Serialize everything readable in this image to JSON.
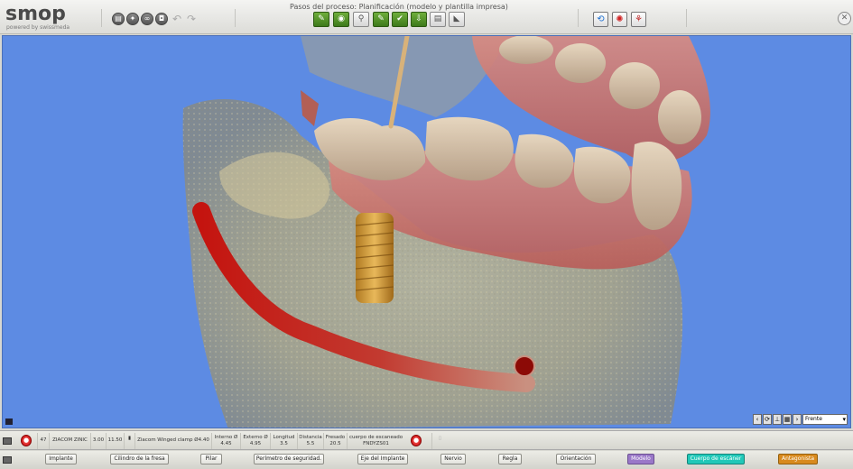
{
  "app": {
    "logo": "smop",
    "logo_sub": "powered by swissmeda"
  },
  "toolbar": {
    "steps_title": "Pasos del proceso: Planificación (modelo y plantilla impresa)",
    "left_tools": [
      "file-icon",
      "lightbulb-icon",
      "link-icon",
      "camera-icon"
    ],
    "undo_icon": "undo-icon",
    "redo_icon": "redo-icon",
    "steps": [
      "step-1",
      "step-2",
      "step-3",
      "step-4",
      "step-5",
      "step-6",
      "step-7",
      "step-8"
    ],
    "view_tools": [
      "view-rotate-icon",
      "view-settings-icon",
      "view-teeth-icon"
    ],
    "close_icon": "close-icon"
  },
  "viewport": {
    "view_select": "Frente",
    "background": "#5d8be3"
  },
  "info": {
    "number": "47",
    "system": "ZIACOM ZINIC",
    "diameter": "3.00",
    "length": "11.50",
    "implant_name": "Ziacom Winged clamp Ø4.40",
    "interno_label": "Interno Ø",
    "interno_value": "4.45",
    "externo_label": "Externo Ø",
    "externo_value": "4.95",
    "longitud_label": "Longitud",
    "longitud_value": "3.5",
    "distancia_label": "Distancia",
    "distancia_value": "5.5",
    "fresado_label": "Fresado",
    "fresado_value": "20.5",
    "cuerpo_label": "cuerpo de escaneado",
    "cuerpo_value": "FNDYZS01"
  },
  "buttons": {
    "implante": "Implante",
    "cilindro": "Cilindro de la fresa",
    "pilar": "Pilar",
    "perimetro": "Perímetro de seguridad.",
    "eje": "Eje del Implante",
    "nervio": "Nervio",
    "regla": "Regla",
    "orientacion": "Orientación",
    "modelo": "Modelo",
    "cuerpo_escaner": "Cuerpo de escáner",
    "antagonista": "Antagonista"
  },
  "colors": {
    "viewport_bg": "#5d8be3",
    "nerve": "#b3140f",
    "modelo": "#9a78c8",
    "cuerpo": "#21c8b8",
    "antagonista": "#d88a1e"
  }
}
